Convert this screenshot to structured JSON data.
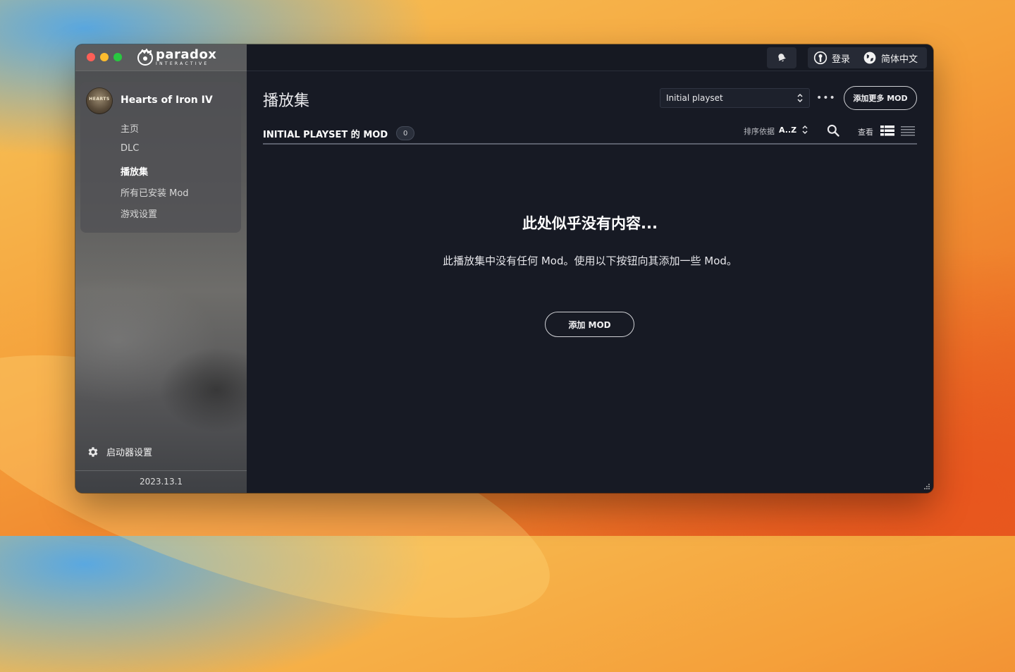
{
  "app": {
    "brand_name": "paradox",
    "brand_subtitle": "INTERACTIVE"
  },
  "sidebar": {
    "game_title": "Hearts of Iron IV",
    "game_avatar_text": "HEARTS",
    "items": [
      {
        "label": "主页",
        "active": false
      },
      {
        "label": "DLC",
        "active": false
      },
      {
        "label": "播放集",
        "active": true
      },
      {
        "label": "所有已安装 Mod",
        "active": false
      },
      {
        "label": "游戏设置",
        "active": false
      }
    ],
    "launcher_settings_label": "启动器设置",
    "version": "2023.13.1"
  },
  "titlebar": {
    "login_label": "登录",
    "language_label": "简体中文"
  },
  "main": {
    "page_title": "播放集",
    "playset_selected": "Initial playset",
    "more_label": "•••",
    "add_more_mods_label": "添加更多 MOD",
    "mods_header": "INITIAL PLAYSET 的 MOD",
    "mod_count": "0",
    "sort_label": "排序依据",
    "sort_value": "A..Z",
    "view_label": "查看",
    "empty_title": "此处似乎没有内容...",
    "empty_description": "此播放集中没有任何 Mod。使用以下按钮向其添加一些 Mod。",
    "add_mod_label": "添加 MOD"
  },
  "colors": {
    "window_bg": "#171a24",
    "titlebar_bg": "#161922",
    "button_border": "#cfd0d4",
    "traffic_red": "#fe5f57",
    "traffic_yellow": "#febc2e",
    "traffic_green": "#28c840"
  },
  "icons": [
    "paradox-logo-icon",
    "bell-icon",
    "account-icon",
    "globe-icon",
    "gear-icon",
    "search-icon",
    "list-view-icon",
    "compact-view-icon",
    "chevron-updown-icon",
    "resize-grip-icon"
  ]
}
